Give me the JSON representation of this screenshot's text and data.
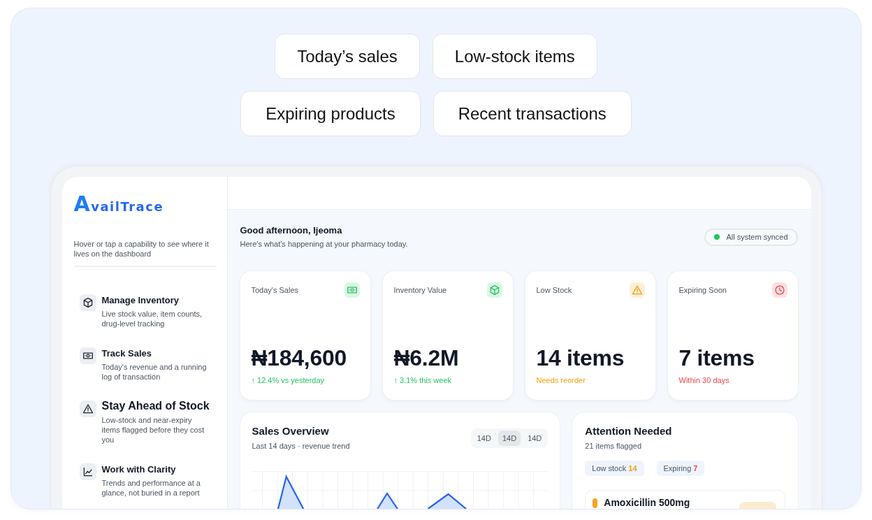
{
  "highlights": [
    "Today’s sales",
    "Low-stock items",
    "Expiring products",
    "Recent transactions"
  ],
  "sidebar": {
    "logo": "AvailTrace",
    "hint": "Hover or tap a capability to see where it lives on the dashboard",
    "capabilities": [
      {
        "kind": "box",
        "title": "Manage Inventory",
        "description": "Live stock value, item counts, drug-level tracking",
        "selected": false
      },
      {
        "kind": "cash",
        "title": "Track Sales",
        "description": "Today's revenue and a running log of transaction",
        "selected": false
      },
      {
        "kind": "warning",
        "title": "Stay Ahead of Stock",
        "description": "Low-stock and near-expiry items flagged before they cost you",
        "selected": true
      },
      {
        "kind": "chart",
        "title": "Work with Clarity",
        "description": "Trends and performance at a glance, not buried in a report",
        "selected": false
      }
    ]
  },
  "header": {
    "greeting": "Good afternoon, Ijeoma",
    "subtitle": "Here's what's happening at your pharmacy today.",
    "status": "All system synced"
  },
  "stats": [
    {
      "kind": "cash",
      "label": "Today's Sales",
      "value": "₦184,600",
      "note": "↑ 12.4% vs yesterday",
      "color": "#22c55e"
    },
    {
      "kind": "box",
      "label": "Inventory Value",
      "value": "₦6.2M",
      "note": "↑ 3.1% this week",
      "color": "#22c55e"
    },
    {
      "kind": "warning",
      "label": "Low Stock",
      "value": "14 items",
      "note": "Needs reorder",
      "color": "#f59e0b"
    },
    {
      "kind": "clock",
      "label": "Expiring Soon",
      "value": "7 items",
      "note": "Within 30 days",
      "color": "#ef4444"
    }
  ],
  "sales_overview": {
    "title": "Sales Overview",
    "subtitle": "Last 14 days · revenue trend",
    "ranges": [
      {
        "label": "14D",
        "selected": false
      },
      {
        "label": "14D",
        "selected": true
      },
      {
        "label": "14D",
        "selected": false
      }
    ]
  },
  "attention": {
    "title": "Attention Needed",
    "subtitle": "21 items flagged",
    "filters": [
      {
        "label": "Low stock",
        "count": "14",
        "color": "#f59e0b"
      },
      {
        "label": "Expiring",
        "count": "7",
        "color": "#ef4444"
      }
    ],
    "items": [
      {
        "name": "Amoxicillin 500mg",
        "color": "#f5a524"
      }
    ]
  }
}
